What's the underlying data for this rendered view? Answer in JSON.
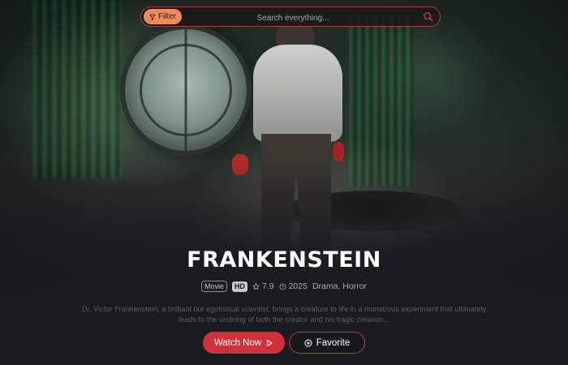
{
  "search": {
    "filter_label": "Filter",
    "placeholder": "Search everything..."
  },
  "movie": {
    "title": "FRANKENSTEIN",
    "type_badge": "Movie",
    "quality_badge": "HD",
    "rating": "7.9",
    "year": "2025",
    "genres": "Drama, Horror",
    "description": "Dr. Victor Frankenstein, a brilliant but egotistical scientist, brings a creature to life in a monstrous experiment that ultimately leads to the undoing of both the creator and his tragic creation..."
  },
  "actions": {
    "watch_label": "Watch Now",
    "favorite_label": "Favorite"
  },
  "icons": {
    "filter": "funnel-icon",
    "search": "search-icon",
    "rating": "star-icon",
    "year": "clock-icon",
    "watch": "play-icon",
    "favorite": "plus-circle-icon"
  },
  "colors": {
    "accent": "#d0313b",
    "filter_pill": "#f08a5d",
    "background": "#1a1b21"
  }
}
